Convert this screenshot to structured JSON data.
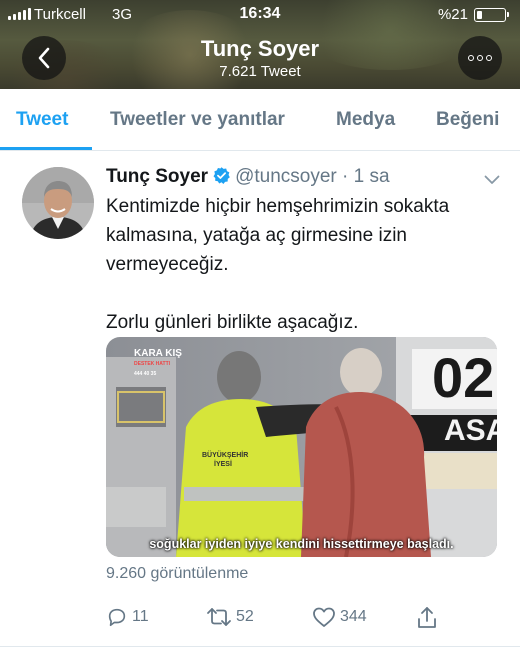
{
  "status_bar": {
    "carrier": "Turkcell",
    "network": "3G",
    "time": "16:34",
    "battery": "%21",
    "battery_level": 0.21
  },
  "header": {
    "title": "Tunç Soyer",
    "subtitle": "7.621 Tweet",
    "back_icon": "chevron-left-icon",
    "more_icon": "more-dots-icon"
  },
  "tabs": [
    {
      "label": "Tweet",
      "active": true
    },
    {
      "label": "Tweetler ve yanıtlar",
      "active": false
    },
    {
      "label": "Medya",
      "active": false
    },
    {
      "label": "Beğeni",
      "active": false
    }
  ],
  "tweet": {
    "name": "Tunç Soyer",
    "handle": "@tuncsoyer",
    "separator": "·",
    "time": "1 sa",
    "text": "Kentimizde hiçbir hemşehrimizin sokakta kalmasına, yatağa aç girmesine izin vermeyeceğiz.\n\nZorlu günleri birlikte aşacağız.",
    "media": {
      "logo_title": "KARA KIŞ",
      "logo_sub": "DESTEK HATTI",
      "logo_phone": "444 40 35",
      "vest_text_line1": "BÜYÜKŞEHİR",
      "vest_text_line2": "İYESİ",
      "truck_number": "02",
      "truck_text": "ASA",
      "caption": "soğuklar iyiden iyiye kendini hissettirmeye başladı."
    },
    "views": "9.260 görüntülenme",
    "actions": {
      "reply_count": "11",
      "retweet_count": "52",
      "like_count": "344"
    }
  },
  "colors": {
    "accent": "#1da1f2",
    "secondary_text": "#657786",
    "primary_text": "#14171a"
  }
}
